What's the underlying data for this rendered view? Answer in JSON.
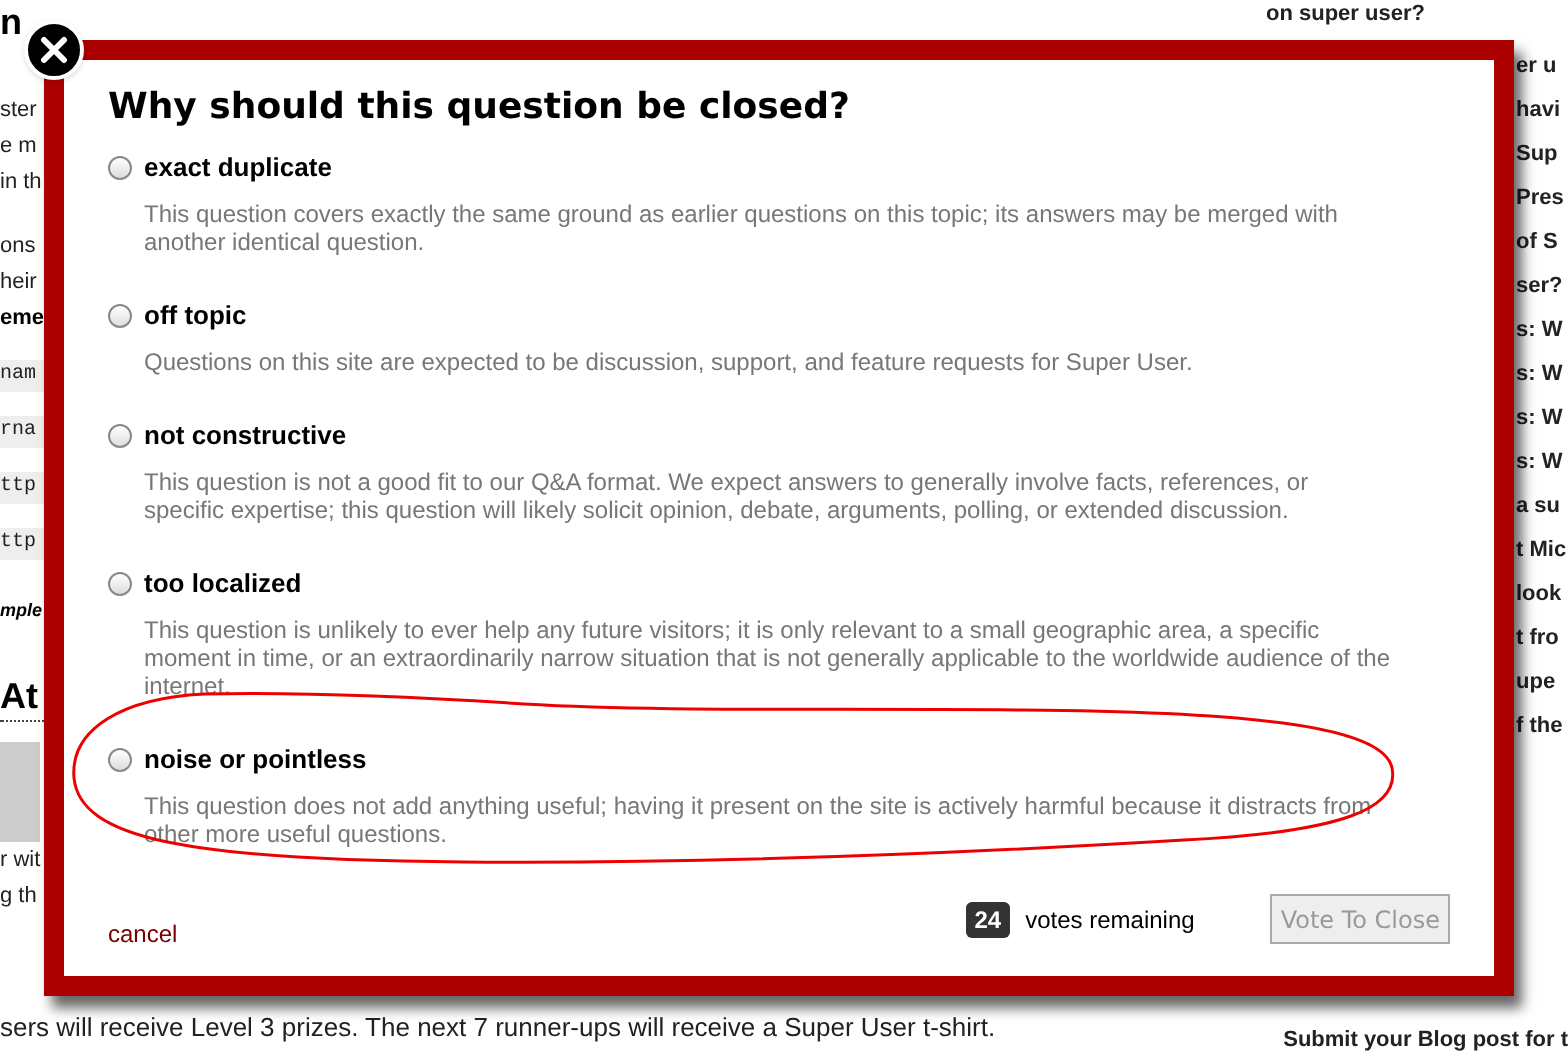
{
  "background": {
    "top_left": "n",
    "top_right": "on super user?",
    "left_fragments": [
      {
        "kind": "text",
        "text": "ster"
      },
      {
        "kind": "text",
        "text": "e m"
      },
      {
        "kind": "text",
        "text": "in th"
      },
      {
        "kind": "gap_text",
        "text": "ons"
      },
      {
        "kind": "text",
        "text": "heir"
      },
      {
        "kind": "bold",
        "text": "eme"
      },
      {
        "kind": "code",
        "text": "nam"
      },
      {
        "kind": "code",
        "text": "rna"
      },
      {
        "kind": "code",
        "text": "ttp"
      },
      {
        "kind": "code",
        "text": "ttp"
      },
      {
        "kind": "emph",
        "text": "mple"
      },
      {
        "kind": "heading",
        "text": "At"
      },
      {
        "kind": "avatar"
      },
      {
        "kind": "text",
        "text": "r wit"
      },
      {
        "kind": "text",
        "text": "g th"
      }
    ],
    "right_fragments": [
      "er u",
      "havi",
      "Sup",
      "Pres",
      "of S",
      "ser?",
      "s: W",
      "s: W",
      "s: W",
      "s: W",
      "a su",
      "t Mic",
      "look",
      "t fro",
      "upe",
      "f the"
    ],
    "bottom_text": "sers will receive Level 3 prizes. The next 7 runner-ups will receive a Super User t-shirt.",
    "bottom_right": "Submit your Blog post for t"
  },
  "dialog": {
    "title": "Why should this question be closed?",
    "options": [
      {
        "label": "exact duplicate",
        "selected": false,
        "description": "This question covers exactly the same ground as earlier questions on this topic; its answers may be merged with another identical question."
      },
      {
        "label": "off topic",
        "selected": false,
        "description": "Questions on this site are expected to be discussion, support, and feature requests for Super User."
      },
      {
        "label": "not constructive",
        "selected": false,
        "description": "This question is not a good fit to our Q&A format. We expect answers to generally involve facts, references, or specific expertise; this question will likely solicit opinion, debate, arguments, polling, or extended discussion."
      },
      {
        "label": "too localized",
        "selected": false,
        "description": "This question is unlikely to ever help any future visitors; it is only relevant to a small geographic area, a specific moment in time, or an extraordinarily narrow situation that is not generally applicable to the worldwide audience of the internet."
      },
      {
        "label": "noise or pointless",
        "selected": false,
        "circled": true,
        "description": "This question does not add anything useful; having it present on the site is actively harmful because it distracts from other more useful questions."
      }
    ],
    "cancel": "cancel",
    "votes_count": "24",
    "votes_label": "votes remaining",
    "submit": {
      "label": "Vote To Close",
      "disabled": true
    }
  }
}
